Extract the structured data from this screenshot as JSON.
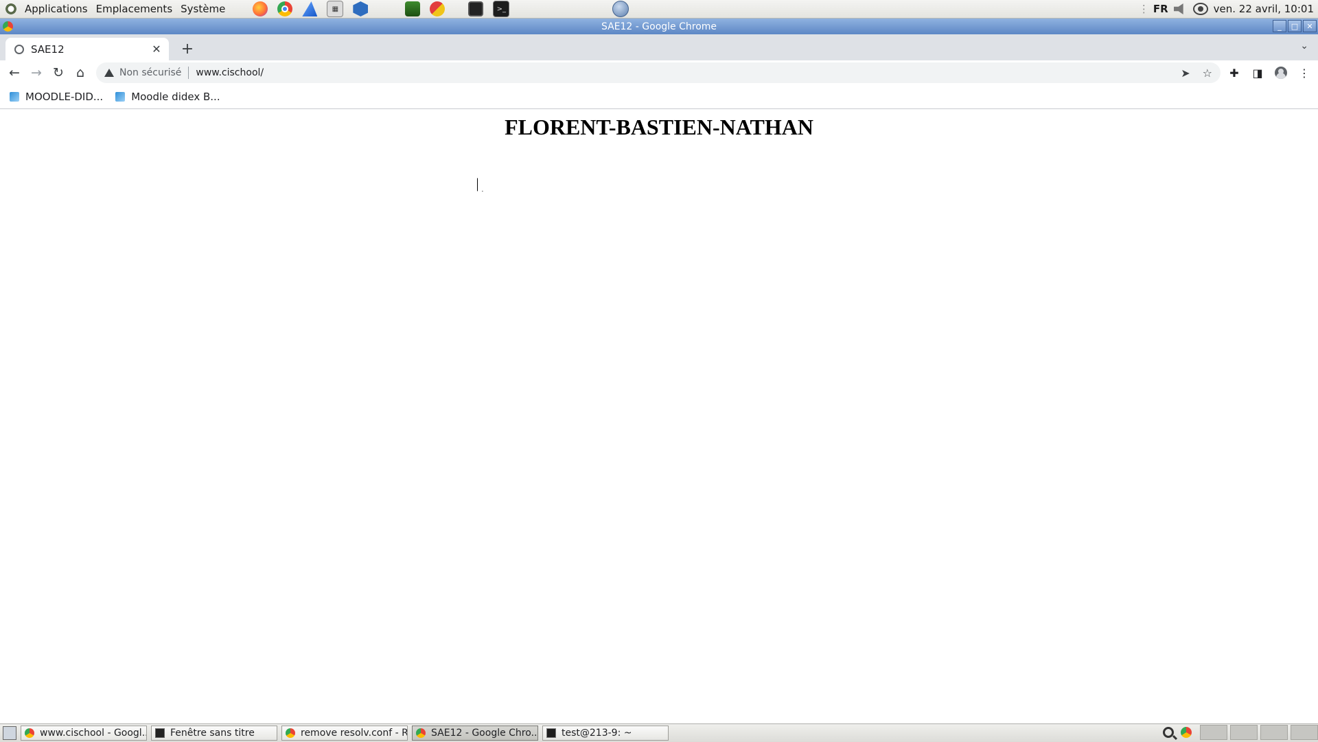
{
  "top_panel": {
    "menus": [
      "Applications",
      "Emplacements",
      "Système"
    ],
    "launchers": [
      "firefox-icon",
      "chrome-icon",
      "wireshark-icon",
      "calculator-icon",
      "virtualbox-icon",
      "gns3-icon",
      "gns3-ws-icon",
      "window-manager-icon",
      "terminal-icon",
      "network-globe-icon"
    ],
    "keyboard_layout": "FR",
    "datetime": "ven. 22 avril, 10:01"
  },
  "window": {
    "title": "SAE12 - Google Chrome"
  },
  "browser": {
    "tab_title": "SAE12",
    "security_label": "Non sécurisé",
    "url": "www.cischool/",
    "bookmarks": [
      "MOODLE-DID...",
      "Moodle didex B..."
    ]
  },
  "page": {
    "heading": "FLORENT-BASTIEN-NATHAN"
  },
  "taskbar": {
    "tasks": [
      {
        "label": "www.cischool - Googl...",
        "icon": "chrome-icon",
        "active": false
      },
      {
        "label": "Fenêtre sans titre",
        "icon": "window-icon",
        "active": false
      },
      {
        "label": "remove resolv.conf - R...",
        "icon": "chrome-icon",
        "active": false
      },
      {
        "label": "SAE12 - Google Chro...",
        "icon": "chrome-icon",
        "active": true
      },
      {
        "label": "test@213-9: ~",
        "icon": "terminal-icon",
        "active": false
      }
    ]
  }
}
